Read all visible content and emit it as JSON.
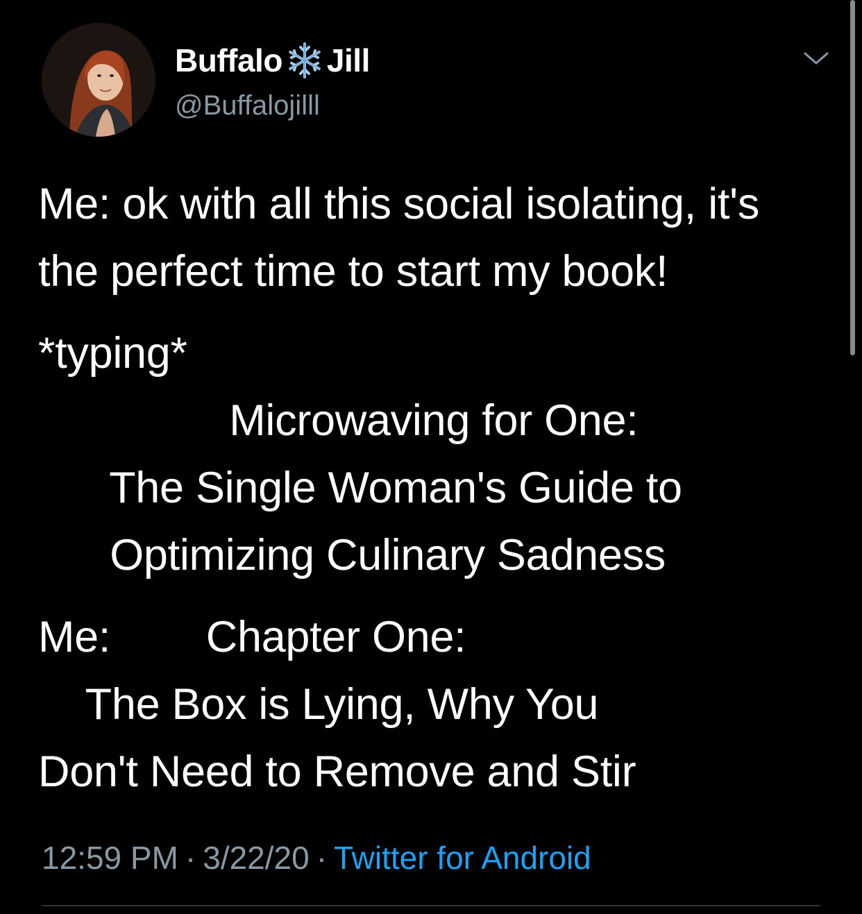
{
  "tweet": {
    "author": {
      "name_part1": "Buffalo",
      "name_emoji": "snowflake-icon",
      "name_part2": "Jill",
      "handle": "@Buffalojilll"
    },
    "lines": [
      "Me: ok with all this social isolating, it's",
      "the perfect time to start my book!",
      "*typing*",
      "                Microwaving for One:",
      "      The Single Woman's Guide to",
      "      Optimizing Culinary Sadness",
      "Me:        Chapter One:",
      "    The Box is Lying, Why You",
      "Don't Need to Remove and Stir"
    ],
    "time": "12:59 PM",
    "separator": "·",
    "date": "3/22/20",
    "source": "Twitter for Android"
  },
  "colors": {
    "background": "#000000",
    "text": "#ffffff",
    "secondary": "#8899a6",
    "link": "#1da1f2"
  },
  "icons": {
    "menu": "chevron-down-icon",
    "avatar": "profile-avatar"
  }
}
